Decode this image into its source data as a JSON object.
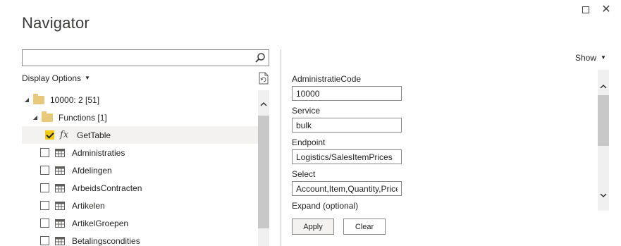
{
  "window": {
    "title": "Navigator",
    "maximize_icon": "maximize-icon",
    "close_icon": "close-icon"
  },
  "search": {
    "value": "",
    "placeholder": ""
  },
  "left_pane": {
    "display_options_label": "Display Options",
    "tree": [
      {
        "label": "10000: 2 [51]",
        "type": "folder",
        "expanded": true,
        "level": 0
      },
      {
        "label": "Functions [1]",
        "type": "folder",
        "expanded": true,
        "level": 1
      },
      {
        "label": "GetTable",
        "type": "function",
        "checked": true,
        "selected": true
      },
      {
        "label": "Administraties",
        "type": "table",
        "checked": false
      },
      {
        "label": "Afdelingen",
        "type": "table",
        "checked": false
      },
      {
        "label": "ArbeidsContracten",
        "type": "table",
        "checked": false
      },
      {
        "label": "Artikelen",
        "type": "table",
        "checked": false
      },
      {
        "label": "ArtikelGroepen",
        "type": "table",
        "checked": false
      },
      {
        "label": "Betalingscondities",
        "type": "table",
        "checked": false
      }
    ]
  },
  "right_pane": {
    "show_label": "Show",
    "fields": [
      {
        "label": "AdministratieCode",
        "value": "10000"
      },
      {
        "label": "Service",
        "value": "bulk"
      },
      {
        "label": "Endpoint",
        "value": "Logistics/SalesItemPrices"
      },
      {
        "label": "Select",
        "value": "Account,Item,Quantity,Price"
      }
    ],
    "expand_label": "Expand (optional)",
    "apply_label": "Apply",
    "clear_label": "Clear"
  }
}
